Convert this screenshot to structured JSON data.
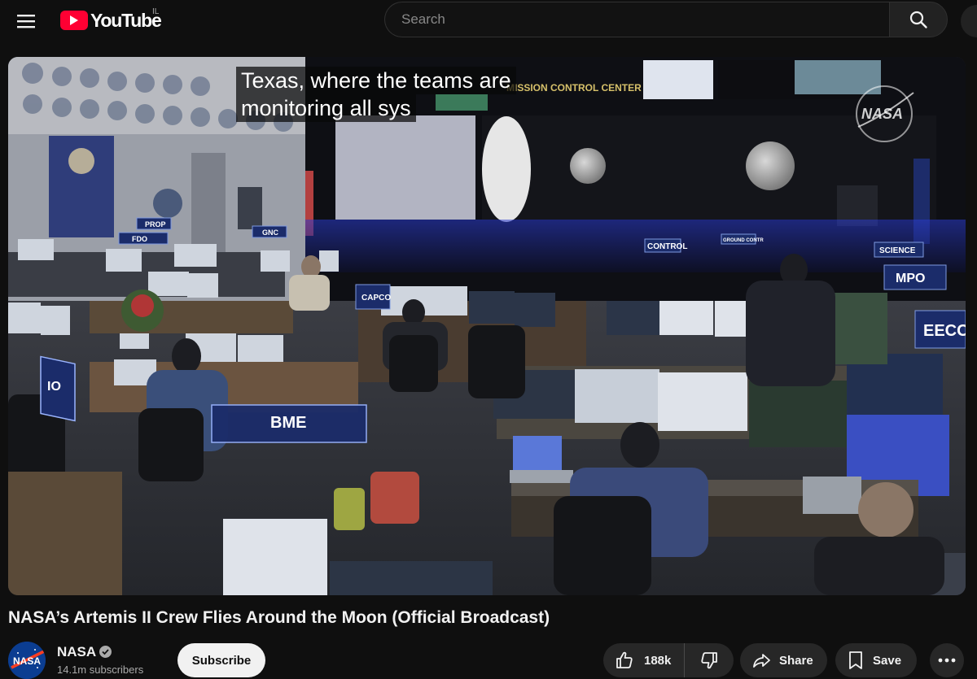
{
  "header": {
    "logo_text": "YouTube",
    "country_code": "IL",
    "search_placeholder": "Search"
  },
  "video": {
    "caption_lines": [
      "Texas, where the teams are",
      "monitoring all sys"
    ],
    "watermark_text": "NASA",
    "scene_labels": {
      "mission_control_center": "MISSION CONTROL CENTER",
      "prop": "PROP",
      "fdo": "FDO",
      "gnc": "GNC",
      "capcom": "CAPCO",
      "control": "CONTROL",
      "ground_control": "GROUND CONTR",
      "science": "SCIENCE",
      "mpo": "MPO",
      "eecom": "EECO",
      "bme": "BME",
      "io": "IO"
    },
    "title": "NASA’s Artemis II Crew Flies Around the Moon (Official Broadcast)"
  },
  "channel": {
    "name": "NASA",
    "avatar_text": "NASA",
    "subscribers": "14.1m subscribers",
    "subscribe_label": "Subscribe"
  },
  "actions": {
    "like_count": "188k",
    "share_label": "Share",
    "save_label": "Save"
  },
  "colors": {
    "background": "#0f0f0f",
    "brand_red": "#ff0033",
    "pill_bg": "#272727",
    "subscribe_bg": "#f1f1f1"
  },
  "icons": [
    "menu-icon",
    "youtube-logo-icon",
    "search-icon",
    "like-icon",
    "dislike-icon",
    "share-icon",
    "save-icon",
    "more-icon",
    "verified-icon"
  ]
}
